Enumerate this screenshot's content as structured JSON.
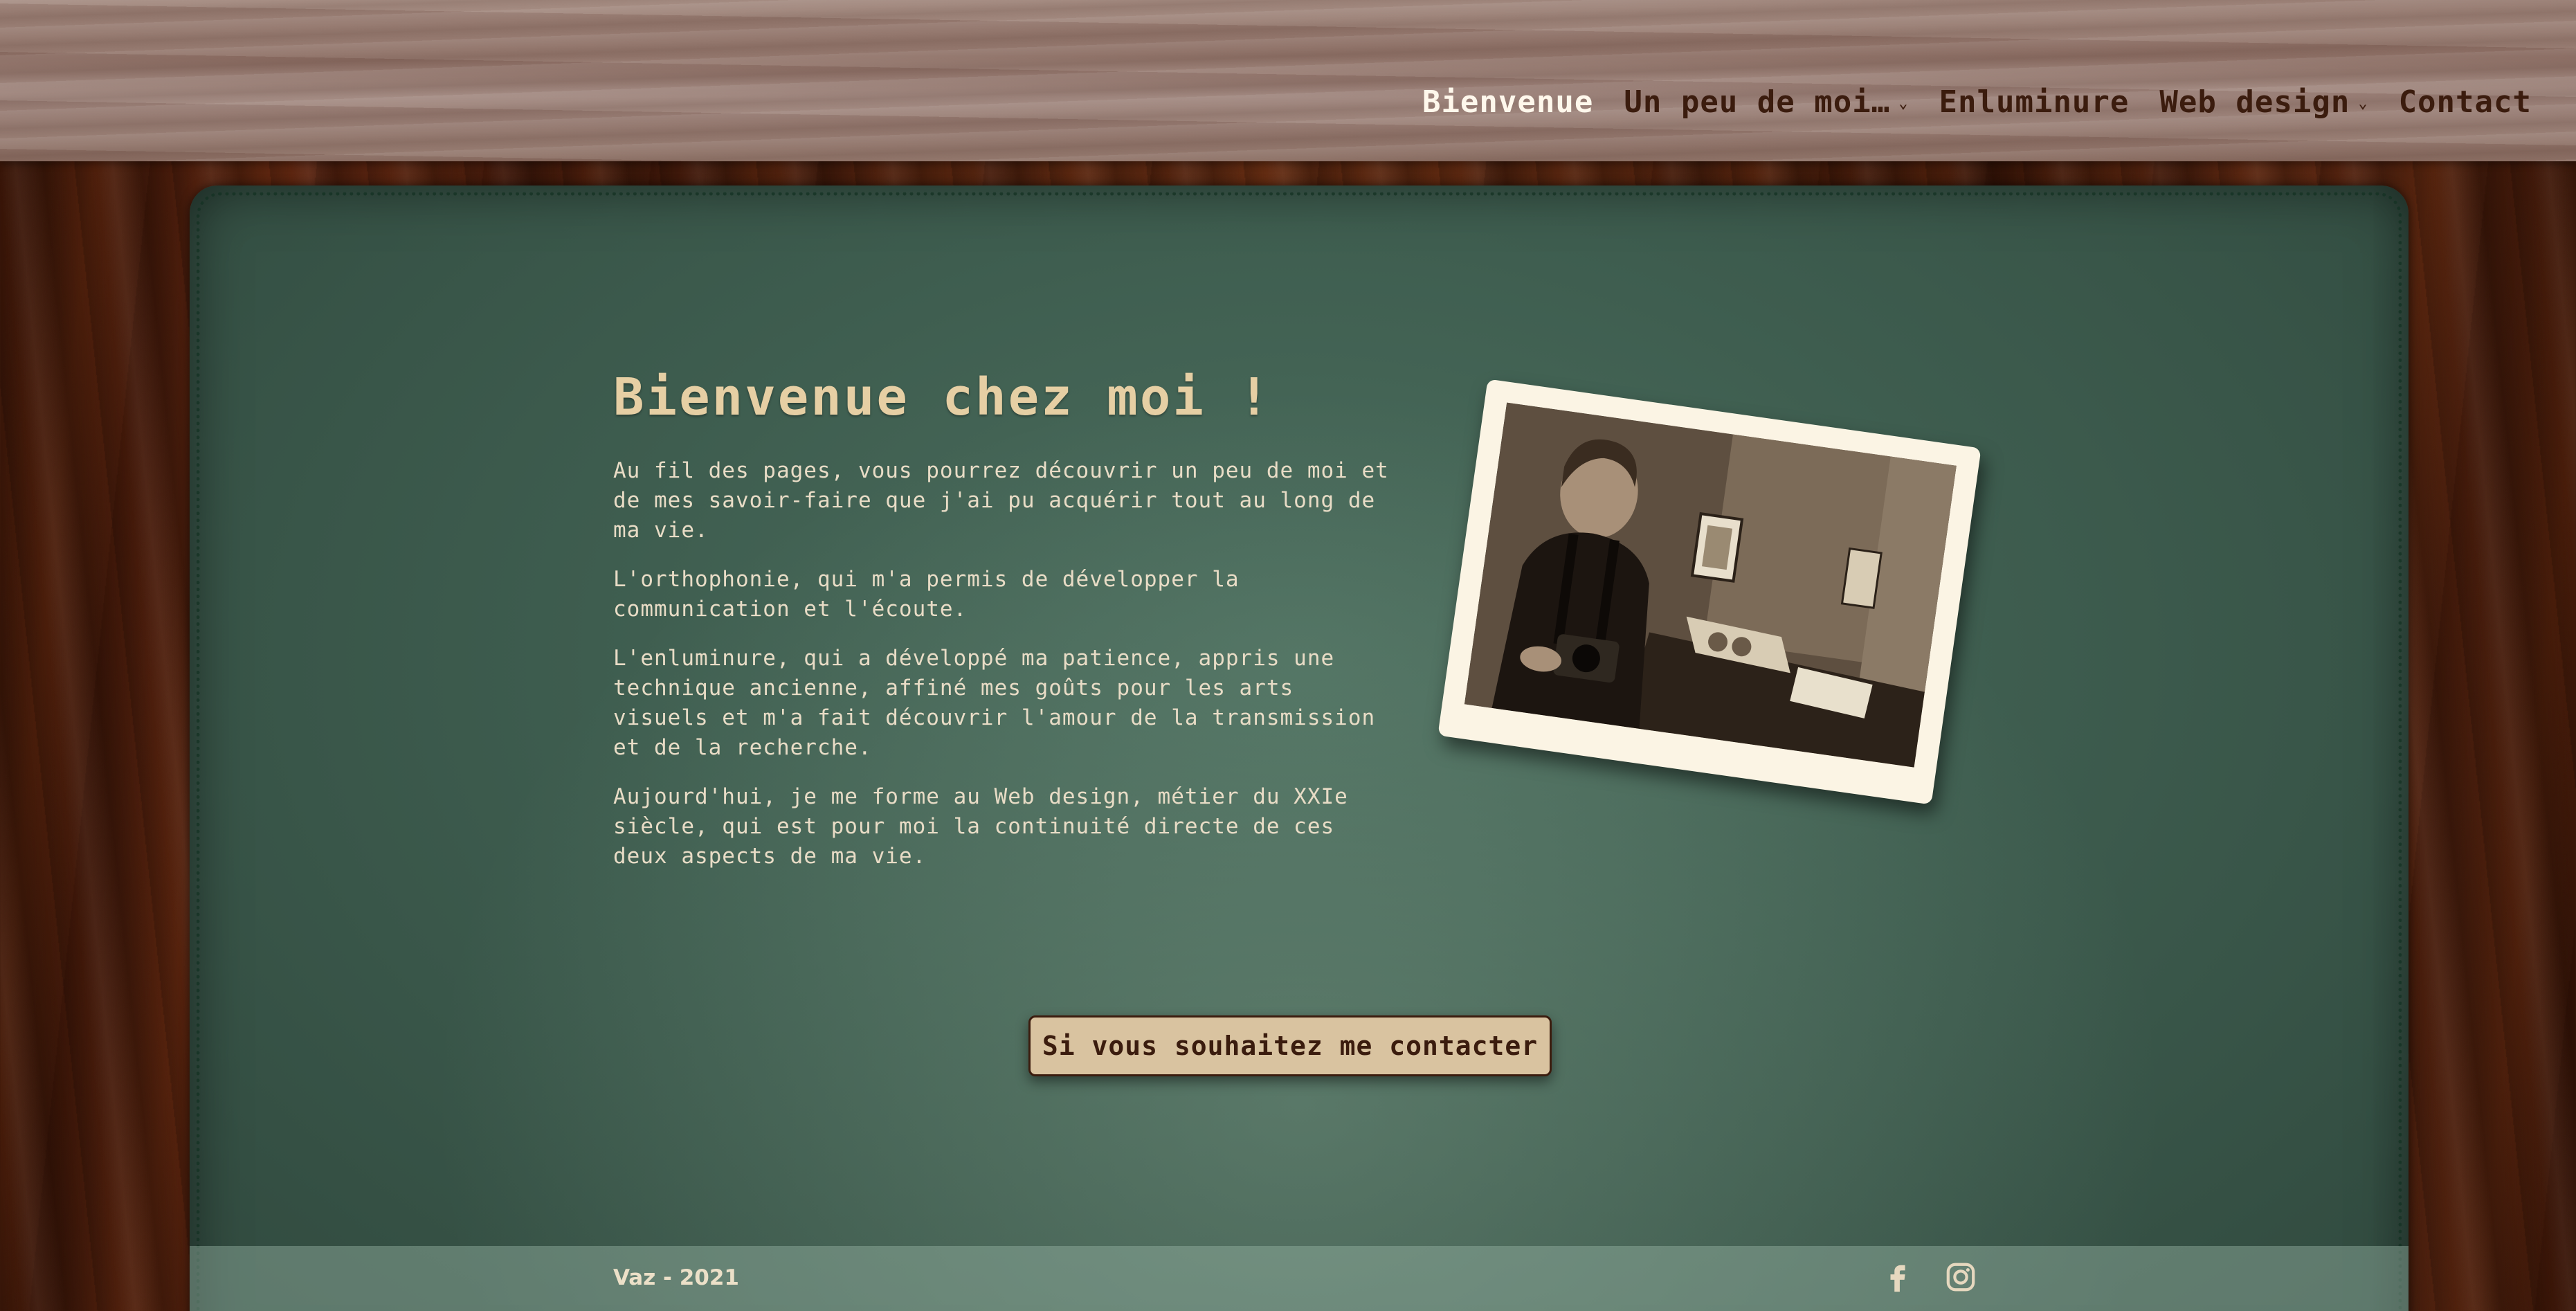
{
  "nav": {
    "items": [
      {
        "label": "Bienvenue",
        "active": true,
        "has_dropdown": false
      },
      {
        "label": "Un peu de moi…",
        "active": false,
        "has_dropdown": true
      },
      {
        "label": "Enluminure",
        "active": false,
        "has_dropdown": false
      },
      {
        "label": "Web design",
        "active": false,
        "has_dropdown": true
      },
      {
        "label": "Contact",
        "active": false,
        "has_dropdown": false
      }
    ],
    "dropdown_icon": "chevron-down-icon"
  },
  "main": {
    "title": "Bienvenue chez moi !",
    "paragraphs": [
      "Au fil des pages, vous pourrez découvrir un peu de moi et de mes savoir-faire que j'ai pu acquérir tout au long de ma vie.",
      "L'orthophonie, qui m'a permis de développer la communication et l'écoute.",
      "L'enluminure, qui a développé ma patience, appris une technique ancienne, affiné mes goûts pour les arts visuels et m'a fait découvrir l'amour de la transmission et de la recherche.",
      "Aujourd'hui, je me forme au Web design, métier du XXIe siècle, qui est pour moi la continuité directe de ces deux aspects de ma vie."
    ],
    "cta_label": "Si vous souhaitez me contacter"
  },
  "footer": {
    "text": "Vaz - 2021",
    "social": [
      "facebook-icon",
      "instagram-icon"
    ]
  },
  "colors": {
    "title": "#e6cfa4",
    "body_text": "#e8dcc6",
    "nav_text": "#3b1c0e",
    "nav_active": "#fff8ec",
    "button_bg": "#d9c3a0",
    "felt_green": "#3e5d4f"
  }
}
